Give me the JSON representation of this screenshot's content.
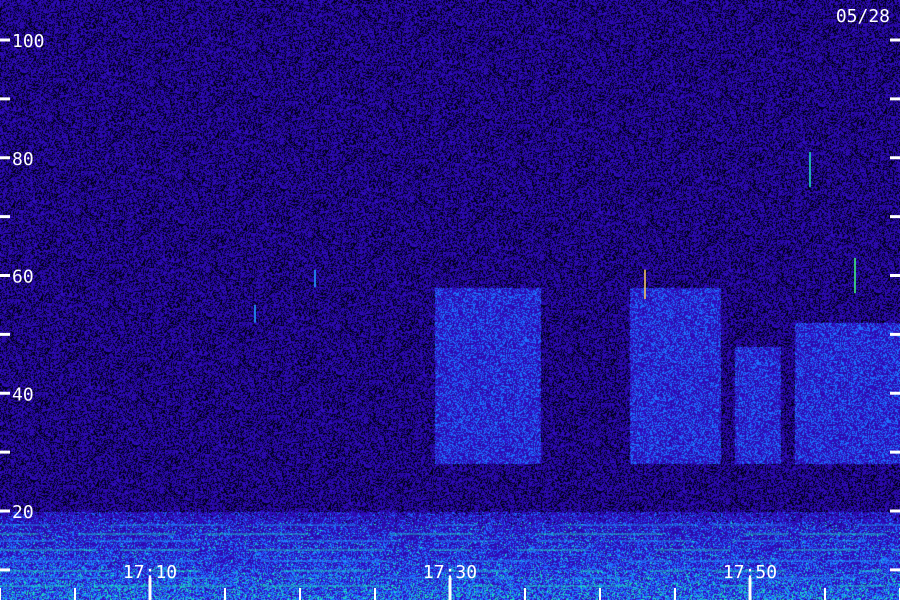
{
  "chart_data": {
    "type": "heatmap",
    "date_label": "05/28",
    "y_axis": {
      "tick_labels": [
        "100",
        "80",
        "60",
        "40",
        "20"
      ],
      "tick_values": [
        100,
        80,
        60,
        40,
        20
      ],
      "minor_tick_values": [
        90,
        70,
        50,
        30,
        10
      ],
      "ylim": [
        10,
        100
      ],
      "side": "left",
      "right_side_ticks": true
    },
    "x_axis": {
      "tick_labels": [
        "17:10",
        "17:30",
        "17:50"
      ],
      "tick_times": [
        "17:10",
        "17:30",
        "17:50"
      ],
      "minor_tick_times": [
        "17:00",
        "17:05",
        "17:15",
        "17:20",
        "17:25",
        "17:35",
        "17:40",
        "17:45",
        "17:55",
        "18:00"
      ],
      "xlim": [
        "17:00",
        "18:00"
      ]
    },
    "colormap": [
      "#000000",
      "#1a0a55",
      "#2a1499",
      "#3322cc",
      "#2a55ff",
      "#20a0ff",
      "#22e0c0",
      "#40ff80"
    ],
    "features": {
      "noise_band_top": 20,
      "enhanced_blocks": [
        {
          "start": "17:29",
          "end": "17:36",
          "low": 28,
          "high": 58
        },
        {
          "start": "17:42",
          "end": "17:48",
          "low": 28,
          "high": 58
        },
        {
          "start": "17:49",
          "end": "17:52",
          "low": 28,
          "high": 48
        },
        {
          "start": "17:53",
          "end": "18:00",
          "low": 28,
          "high": 52
        }
      ]
    },
    "spikes": [
      {
        "time": "17:54",
        "low": 75,
        "high": 81,
        "color": "#22e0c0"
      },
      {
        "time": "17:57",
        "low": 57,
        "high": 63,
        "color": "#40ff80"
      },
      {
        "time": "17:43",
        "low": 56,
        "high": 61,
        "color": "#ffd060"
      },
      {
        "time": "17:21",
        "low": 58,
        "high": 61,
        "color": "#20a0ff"
      },
      {
        "time": "17:17",
        "low": 52,
        "high": 55,
        "color": "#20a0ff"
      }
    ]
  }
}
